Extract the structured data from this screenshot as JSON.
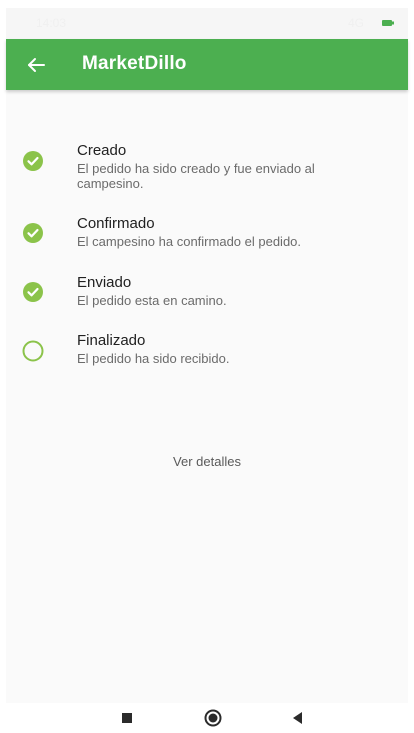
{
  "status_bar": {
    "time": "14:03",
    "network": "4G",
    "battery_color": "#4caf50"
  },
  "app_bar": {
    "title": "MarketDillo",
    "background": "#4caf50",
    "back_icon": "arrow-left-icon"
  },
  "steps": [
    {
      "title": "Creado",
      "description": "El pedido ha sido creado y fue enviado al campesino.",
      "status": "done",
      "icon": "check-circle-icon"
    },
    {
      "title": "Confirmado",
      "description": "El campesino ha  confirmado el pedido.",
      "status": "done",
      "icon": "check-circle-icon"
    },
    {
      "title": "Enviado",
      "description": "El pedido esta en camino.",
      "status": "done",
      "icon": "check-circle-icon"
    },
    {
      "title": "Finalizado",
      "description": "El pedido ha sido recibido.",
      "status": "pending",
      "icon": "empty-circle-icon"
    }
  ],
  "details_link": "Ver detalles",
  "step_color": "#8bc34a",
  "nav_bar": {
    "buttons": [
      "recent-apps-icon",
      "home-icon",
      "back-icon"
    ]
  }
}
